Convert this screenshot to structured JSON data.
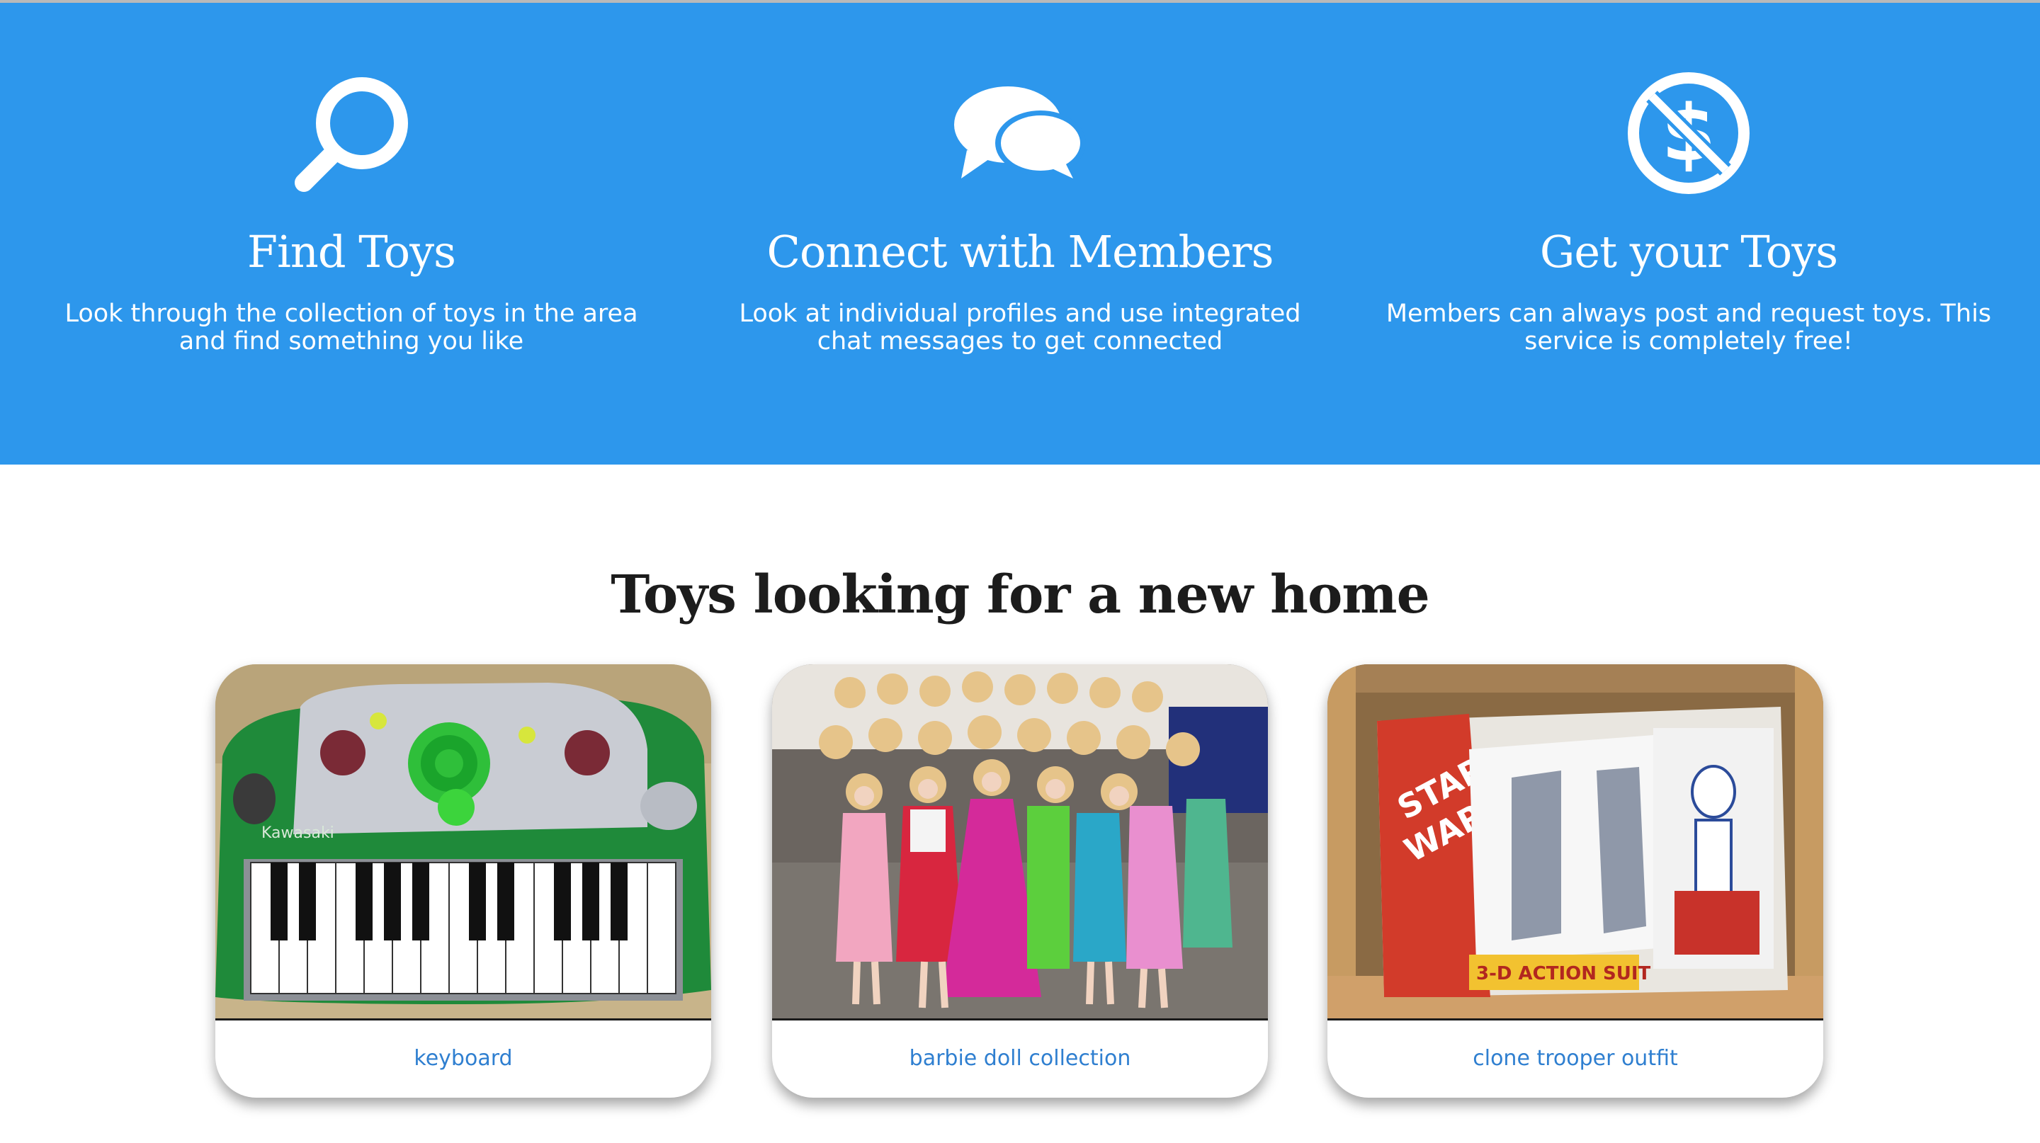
{
  "colors": {
    "hero_background": "#2d97ec",
    "link": "#2f7fd0",
    "heading": "#1c1c1c"
  },
  "features": [
    {
      "icon": "search-icon",
      "title": "Find Toys",
      "description": "Look through the collection of toys in the area and find something you like"
    },
    {
      "icon": "chat-bubbles-icon",
      "title": "Connect with Members",
      "description": "Look at individual profiles and use integrated chat messages to get connected"
    },
    {
      "icon": "no-dollar-icon",
      "title": "Get your Toys",
      "description": "Members can always post and request toys. This service is completely free!"
    }
  ],
  "toys_section": {
    "title": "Toys looking for a new home",
    "cards": [
      {
        "image": "keyboard-photo",
        "label": "keyboard"
      },
      {
        "image": "barbie-dolls-photo",
        "label": "barbie doll collection"
      },
      {
        "image": "clone-trooper-box-photo",
        "label": "clone trooper outfit"
      }
    ]
  }
}
